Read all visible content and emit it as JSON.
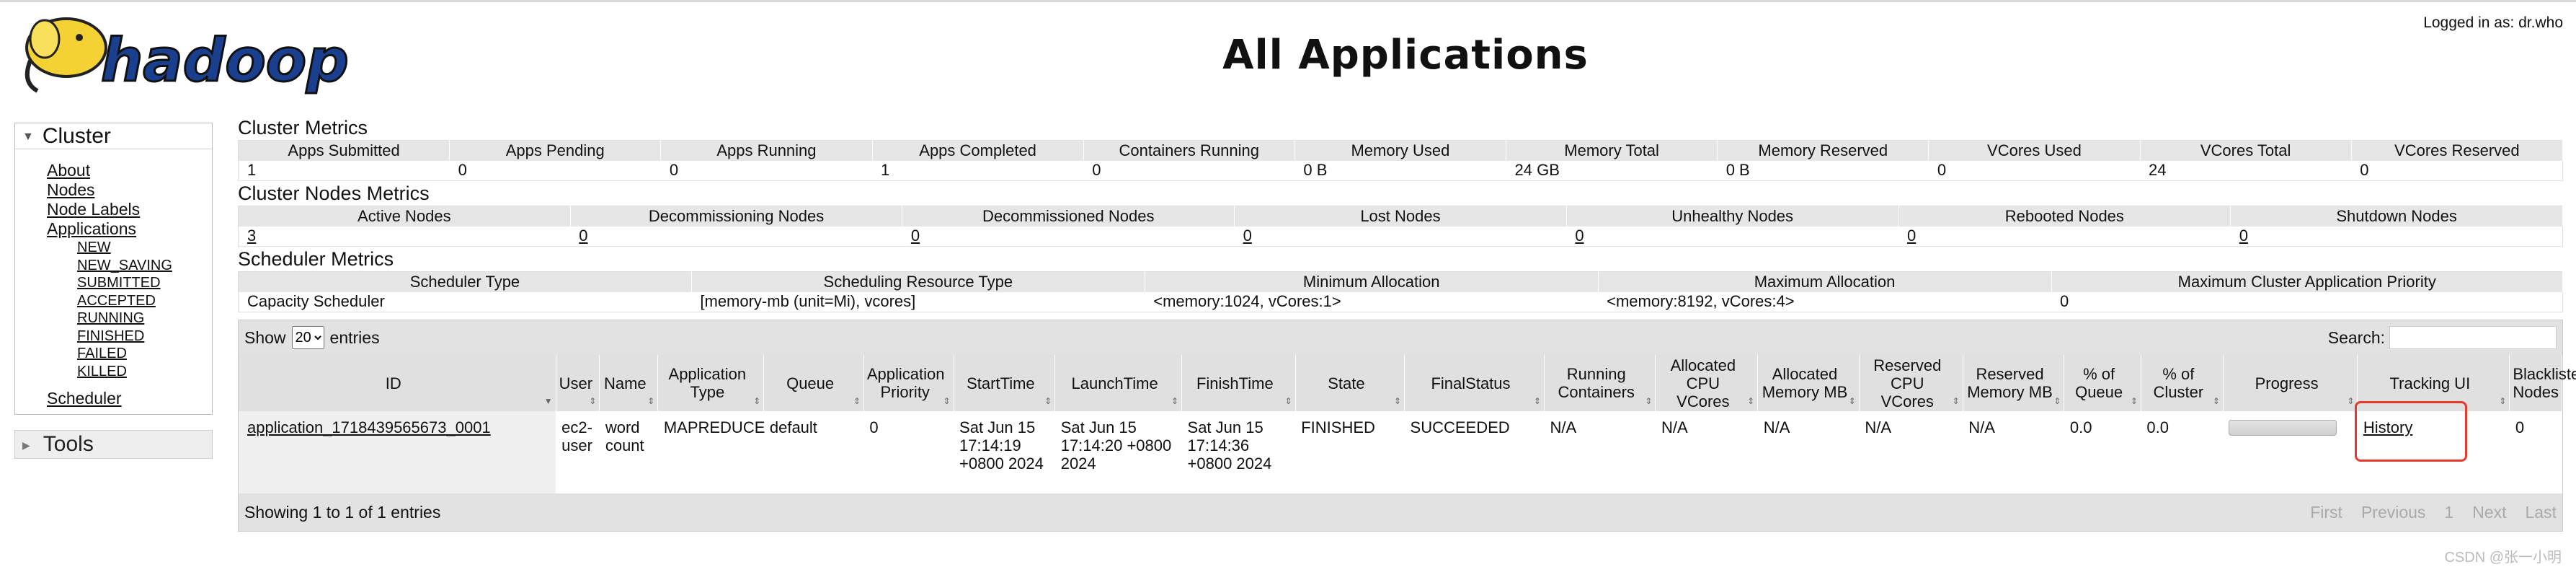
{
  "header": {
    "title": "All Applications",
    "logged_in": "Logged in as: dr.who",
    "logo_alt": "hadoop"
  },
  "sidebar": {
    "cluster_label": "Cluster",
    "items": [
      {
        "label": "About"
      },
      {
        "label": "Nodes"
      },
      {
        "label": "Node Labels"
      },
      {
        "label": "Applications"
      }
    ],
    "app_states": [
      "NEW",
      "NEW_SAVING",
      "SUBMITTED",
      "ACCEPTED",
      "RUNNING",
      "FINISHED",
      "FAILED",
      "KILLED"
    ],
    "scheduler": "Scheduler",
    "tools_label": "Tools"
  },
  "cluster_metrics": {
    "title": "Cluster Metrics",
    "headers": [
      "Apps Submitted",
      "Apps Pending",
      "Apps Running",
      "Apps Completed",
      "Containers Running",
      "Memory Used",
      "Memory Total",
      "Memory Reserved",
      "VCores Used",
      "VCores Total",
      "VCores Reserved"
    ],
    "values": [
      "1",
      "0",
      "0",
      "1",
      "0",
      "0 B",
      "24 GB",
      "0 B",
      "0",
      "24",
      "0"
    ]
  },
  "nodes_metrics": {
    "title": "Cluster Nodes Metrics",
    "headers": [
      "Active Nodes",
      "Decommissioning Nodes",
      "Decommissioned Nodes",
      "Lost Nodes",
      "Unhealthy Nodes",
      "Rebooted Nodes",
      "Shutdown Nodes"
    ],
    "values": [
      "3",
      "0",
      "0",
      "0",
      "0",
      "0",
      "0"
    ]
  },
  "scheduler_metrics": {
    "title": "Scheduler Metrics",
    "headers": [
      "Scheduler Type",
      "Scheduling Resource Type",
      "Minimum Allocation",
      "Maximum Allocation",
      "Maximum Cluster Application Priority"
    ],
    "values": [
      "Capacity Scheduler",
      "[memory-mb (unit=Mi), vcores]",
      "<memory:1024, vCores:1>",
      "<memory:8192, vCores:4>",
      "0"
    ]
  },
  "apps": {
    "show_label": "Show",
    "page_size": "20",
    "entries_label": "entries",
    "search_label": "Search:",
    "columns": [
      "ID",
      "User",
      "Name",
      "Application Type",
      "Queue",
      "Application Priority",
      "StartTime",
      "LaunchTime",
      "FinishTime",
      "State",
      "FinalStatus",
      "Running Containers",
      "Allocated CPU VCores",
      "Allocated Memory MB",
      "Reserved CPU VCores",
      "Reserved Memory MB",
      "% of Queue",
      "% of Cluster",
      "Progress",
      "Tracking UI",
      "Blacklisted Nodes"
    ],
    "row": {
      "id": "application_1718439565673_0001",
      "user": "ec2-user",
      "name": "word count",
      "type": "MAPREDUCE",
      "queue": "default",
      "priority": "0",
      "start": "Sat Jun 15 17:14:19 +0800 2024",
      "launch": "Sat Jun 15 17:14:20 +0800 2024",
      "finish": "Sat Jun 15 17:14:36 +0800 2024",
      "state": "FINISHED",
      "final_status": "SUCCEEDED",
      "running_containers": "N/A",
      "alloc_vcores": "N/A",
      "alloc_mem": "N/A",
      "res_vcores": "N/A",
      "res_mem": "N/A",
      "pct_queue": "0.0",
      "pct_cluster": "0.0",
      "progress": 1.0,
      "tracking_ui": "History",
      "blacklisted": "0"
    },
    "showing": "Showing 1 to 1 of 1 entries",
    "pager": {
      "first": "First",
      "previous": "Previous",
      "page": "1",
      "next": "Next",
      "last": "Last"
    }
  },
  "watermark": "CSDN @张一小明",
  "colors": {
    "highlight_box": "#e23a2e",
    "header_bg": "#e6e6e6"
  }
}
